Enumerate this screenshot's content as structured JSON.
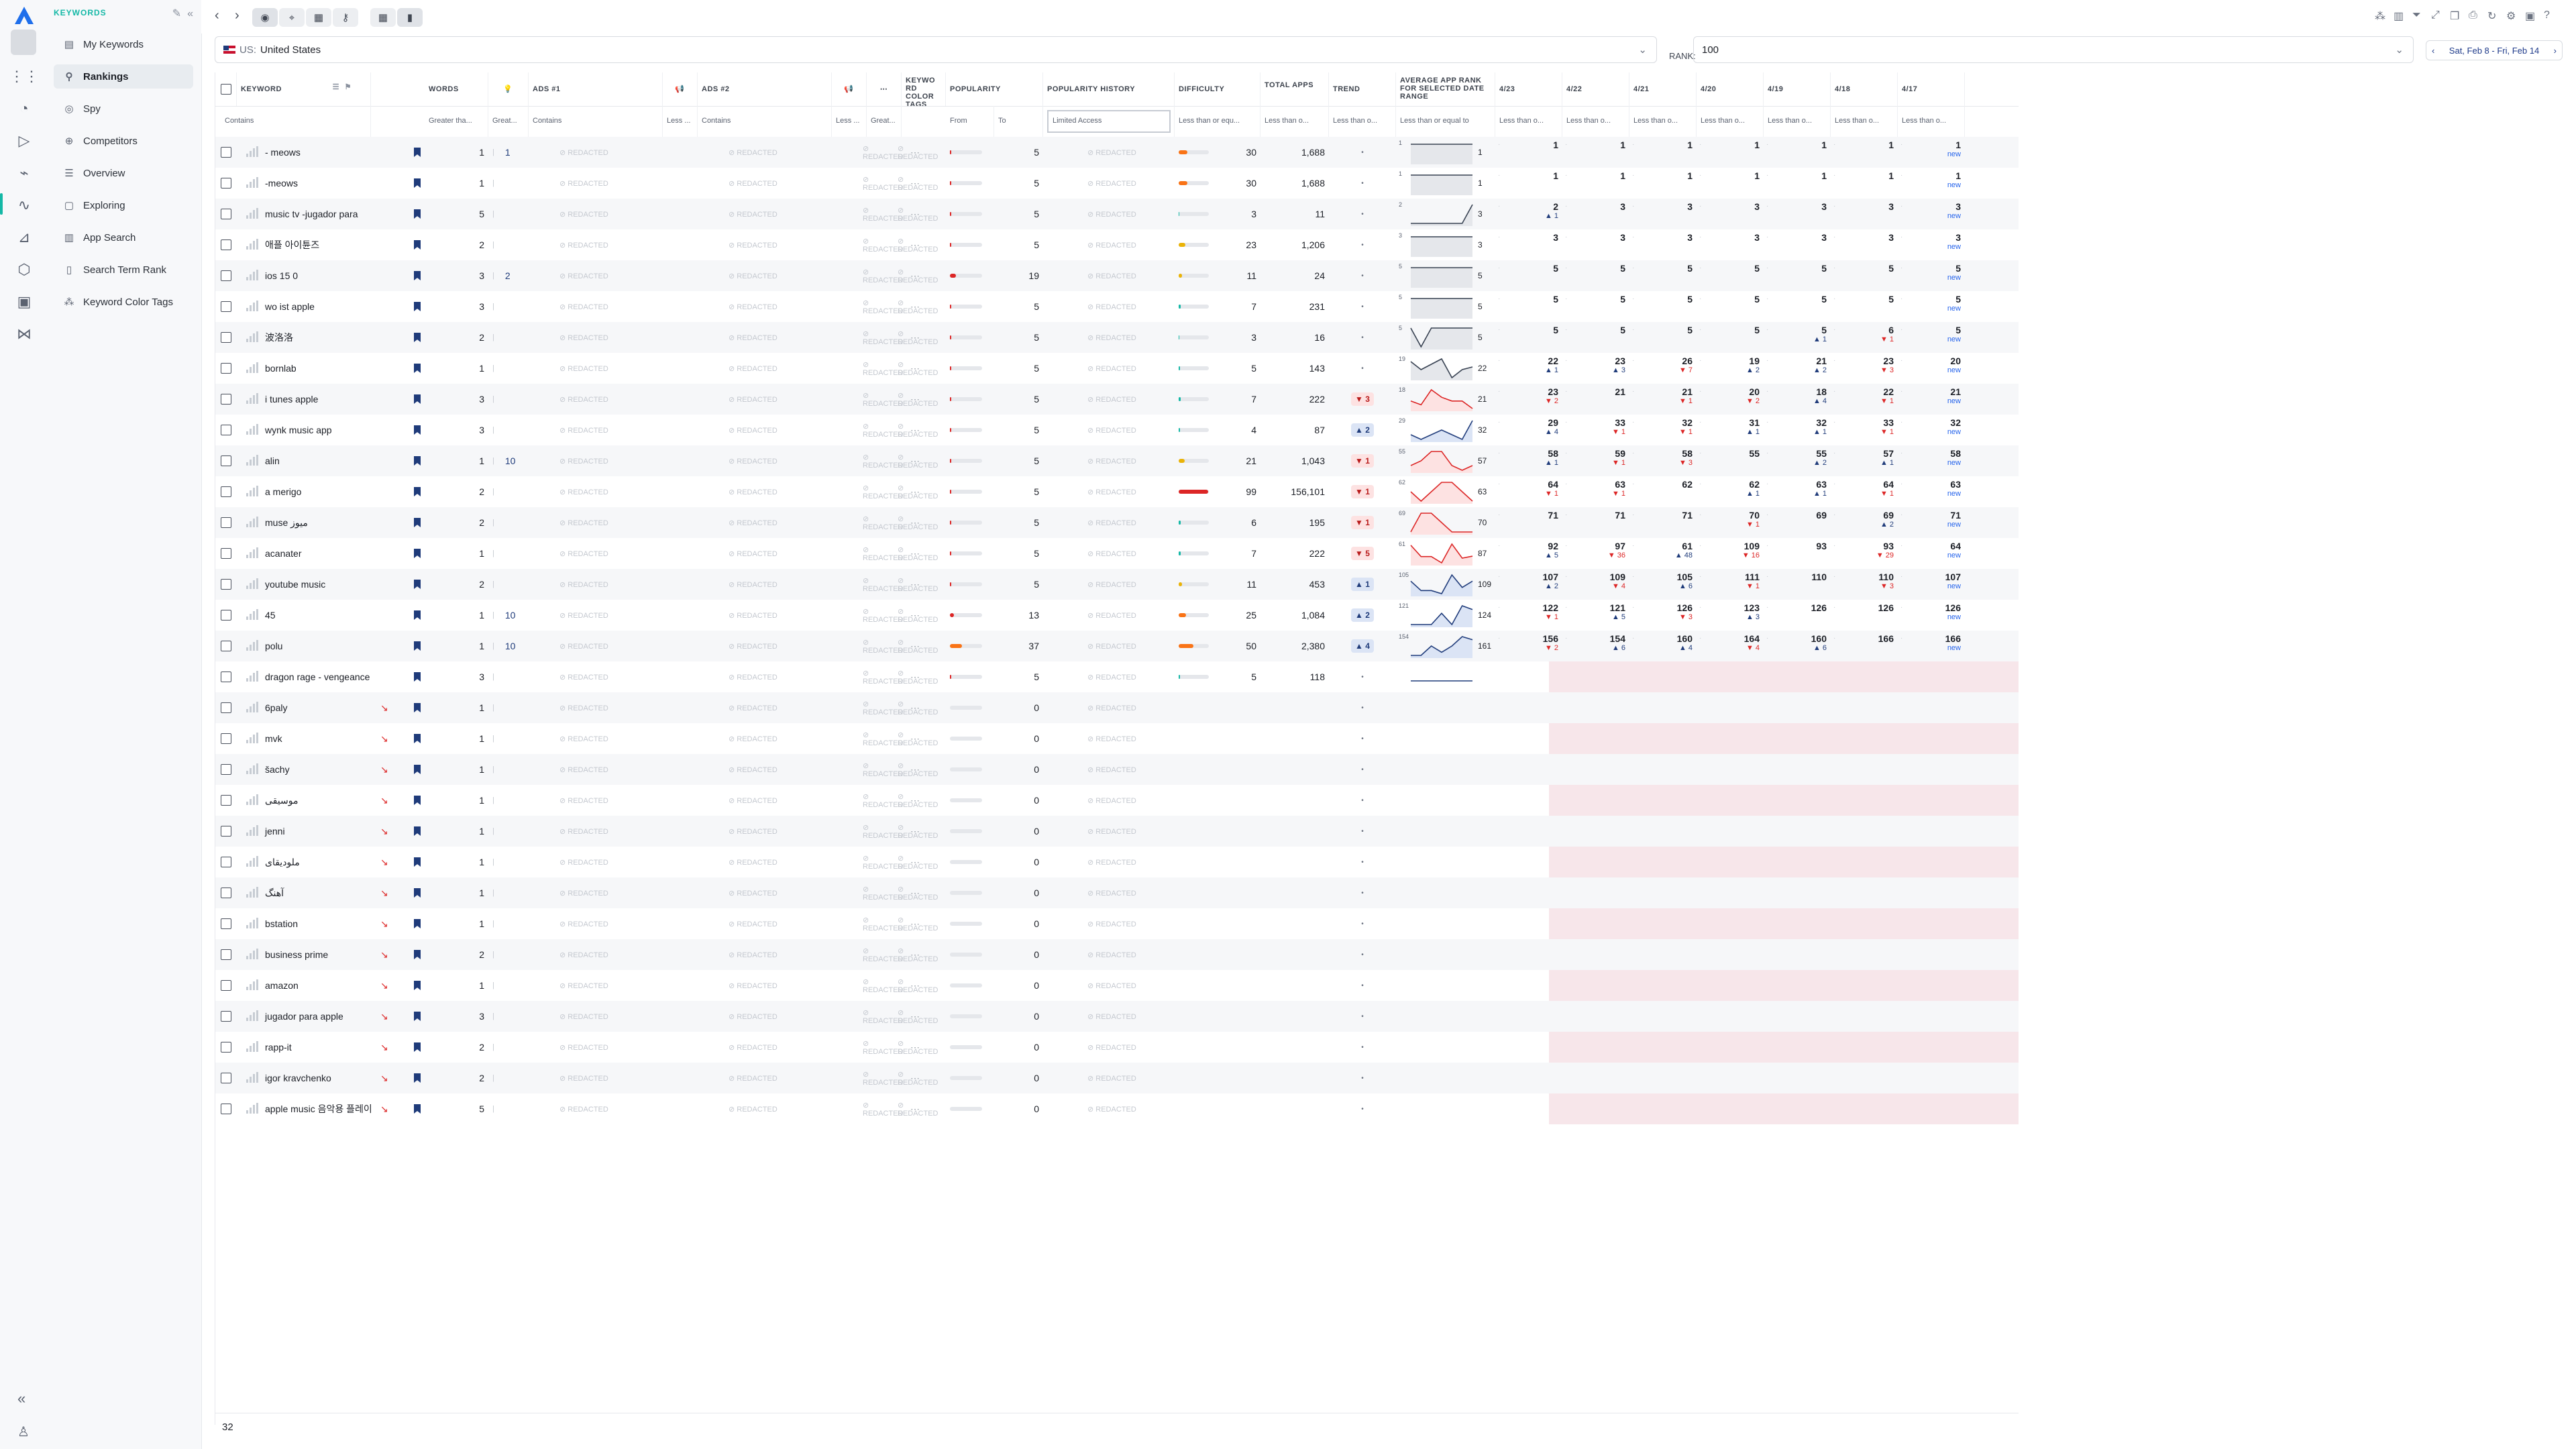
{
  "nav": {
    "section_title": "KEYWORDS",
    "items": [
      {
        "label": "My Keywords",
        "icon": "file-icon",
        "active": false
      },
      {
        "label": "Rankings",
        "icon": "search-icon",
        "active": true
      },
      {
        "label": "Spy",
        "icon": "spy-icon",
        "active": false
      },
      {
        "label": "Competitors",
        "icon": "target-icon",
        "active": false
      },
      {
        "label": "Overview",
        "icon": "list-icon",
        "active": false
      },
      {
        "label": "Exploring",
        "icon": "box-icon",
        "active": false
      },
      {
        "label": "App Search",
        "icon": "chart-icon",
        "active": false
      },
      {
        "label": "Search Term Rank",
        "icon": "doc-icon",
        "active": false
      },
      {
        "label": "Keyword Color Tags",
        "icon": "tags-icon",
        "active": false
      }
    ]
  },
  "filters": {
    "country_code": "US:",
    "country": "United States",
    "rank_label": "RANK:",
    "rank_value": "100",
    "date_range": "Sat, Feb 8 - Fri, Feb 14"
  },
  "columns": {
    "keyword": "KEYWORD",
    "words": "WORDS",
    "ads1": "ADS #1",
    "ads2": "ADS #2",
    "color_tags": "KEYWO RD COLOR TAGS",
    "popularity": "POPULARITY",
    "popularity_history": "POPULARITY HISTORY",
    "difficulty": "DIFFICULTY",
    "total_apps": "TOTAL APPS",
    "trend": "TREND",
    "avg_rank": "AVERAGE APP RANK FOR SELECTED DATE RANGE",
    "dates": [
      "4/23",
      "4/22",
      "4/21",
      "4/20",
      "4/19",
      "4/18",
      "4/17"
    ]
  },
  "filter_row": {
    "keyword": "Contains",
    "words": "Greater tha...",
    "bulb": "Great...",
    "ads1": "Contains",
    "ads1_less": "Less ...",
    "ads2": "Contains",
    "ads2_less": "Less ...",
    "ads2_great": "Great...",
    "pop_from": "From",
    "pop_to": "To",
    "pop_history": "Limited Access",
    "difficulty": "Less than or equ...",
    "total_apps": "Less than o...",
    "trend": "Less than o...",
    "avg_rank": "Less than or equal to",
    "date_filter": "Less than o..."
  },
  "rows": [
    {
      "keyword": "- meows",
      "words": "1",
      "bulb": "1",
      "pop": 5,
      "diff": 30,
      "total": "1,688",
      "trend": "•",
      "avg_start": "1",
      "avg": "1",
      "ranks": [
        [
          "1",
          ""
        ],
        [
          "1",
          ""
        ],
        [
          "1",
          ""
        ],
        [
          "1",
          ""
        ],
        [
          "1",
          ""
        ],
        [
          "1",
          ""
        ],
        [
          "1",
          "new"
        ]
      ]
    },
    {
      "keyword": "-meows",
      "words": "1",
      "bulb": "",
      "pop": 5,
      "diff": 30,
      "total": "1,688",
      "trend": "•",
      "avg_start": "1",
      "avg": "1",
      "ranks": [
        [
          "1",
          ""
        ],
        [
          "1",
          ""
        ],
        [
          "1",
          ""
        ],
        [
          "1",
          ""
        ],
        [
          "1",
          ""
        ],
        [
          "1",
          ""
        ],
        [
          "1",
          "new"
        ]
      ]
    },
    {
      "keyword": "music tv -jugador para",
      "words": "5",
      "bulb": "",
      "pop": 5,
      "diff": 3,
      "total": "11",
      "trend": "•",
      "avg_start": "2",
      "avg": "3",
      "ranks": [
        [
          "2",
          "▲ 1"
        ],
        [
          "3",
          ""
        ],
        [
          "3",
          ""
        ],
        [
          "3",
          ""
        ],
        [
          "3",
          ""
        ],
        [
          "3",
          ""
        ],
        [
          "3",
          "new"
        ]
      ]
    },
    {
      "keyword": "애플 아이튠즈",
      "words": "2",
      "bulb": "",
      "pop": 5,
      "diff": 23,
      "total": "1,206",
      "trend": "•",
      "avg_start": "3",
      "avg": "3",
      "ranks": [
        [
          "3",
          ""
        ],
        [
          "3",
          ""
        ],
        [
          "3",
          ""
        ],
        [
          "3",
          ""
        ],
        [
          "3",
          ""
        ],
        [
          "3",
          ""
        ],
        [
          "3",
          "new"
        ]
      ]
    },
    {
      "keyword": "ios 15 0",
      "words": "3",
      "bulb": "2",
      "pop": 19,
      "diff": 11,
      "total": "24",
      "trend": "•",
      "avg_start": "5",
      "avg": "5",
      "ranks": [
        [
          "5",
          ""
        ],
        [
          "5",
          ""
        ],
        [
          "5",
          ""
        ],
        [
          "5",
          ""
        ],
        [
          "5",
          ""
        ],
        [
          "5",
          ""
        ],
        [
          "5",
          "new"
        ]
      ]
    },
    {
      "keyword": "wo ist apple",
      "words": "3",
      "bulb": "",
      "pop": 5,
      "diff": 7,
      "total": "231",
      "trend": "•",
      "avg_start": "5",
      "avg": "5",
      "ranks": [
        [
          "5",
          ""
        ],
        [
          "5",
          ""
        ],
        [
          "5",
          ""
        ],
        [
          "5",
          ""
        ],
        [
          "5",
          ""
        ],
        [
          "5",
          ""
        ],
        [
          "5",
          "new"
        ]
      ]
    },
    {
      "keyword": "波洛洛",
      "words": "2",
      "bulb": "",
      "pop": 5,
      "diff": 3,
      "total": "16",
      "trend": "•",
      "avg_start": "5",
      "avg": "5",
      "ranks": [
        [
          "5",
          ""
        ],
        [
          "5",
          ""
        ],
        [
          "5",
          ""
        ],
        [
          "5",
          ""
        ],
        [
          "5",
          "▲ 1"
        ],
        [
          "6",
          "▼ 1"
        ],
        [
          "5",
          "new"
        ]
      ]
    },
    {
      "keyword": "bornlab",
      "words": "1",
      "bulb": "",
      "pop": 5,
      "diff": 5,
      "total": "143",
      "trend": "•",
      "avg_start": "19",
      "avg": "22",
      "ranks": [
        [
          "22",
          "▲ 1"
        ],
        [
          "23",
          "▲ 3"
        ],
        [
          "26",
          "▼ 7"
        ],
        [
          "19",
          "▲ 2"
        ],
        [
          "21",
          "▲ 2"
        ],
        [
          "23",
          "▼ 3"
        ],
        [
          "20",
          "new"
        ]
      ]
    },
    {
      "keyword": "i tunes apple",
      "words": "3",
      "bulb": "",
      "pop": 5,
      "diff": 7,
      "total": "222",
      "trend": "▼ 3",
      "avg_start": "18",
      "avg": "21",
      "ranks": [
        [
          "23",
          "▼ 2"
        ],
        [
          "21",
          ""
        ],
        [
          "21",
          "▼ 1"
        ],
        [
          "20",
          "▼ 2"
        ],
        [
          "18",
          "▲ 4"
        ],
        [
          "22",
          "▼ 1"
        ],
        [
          "21",
          "new"
        ]
      ]
    },
    {
      "keyword": "wynk music app",
      "words": "3",
      "bulb": "",
      "pop": 5,
      "diff": 4,
      "total": "87",
      "trend": "▲ 2",
      "avg_start": "29",
      "avg": "32",
      "ranks": [
        [
          "29",
          "▲ 4"
        ],
        [
          "33",
          "▼ 1"
        ],
        [
          "32",
          "▼ 1"
        ],
        [
          "31",
          "▲ 1"
        ],
        [
          "32",
          "▲ 1"
        ],
        [
          "33",
          "▼ 1"
        ],
        [
          "32",
          "new"
        ]
      ]
    },
    {
      "keyword": "alin",
      "words": "1",
      "bulb": "10",
      "pop": 5,
      "diff": 21,
      "total": "1,043",
      "trend": "▼ 1",
      "avg_start": "55",
      "avg": "57",
      "ranks": [
        [
          "58",
          "▲ 1"
        ],
        [
          "59",
          "▼ 1"
        ],
        [
          "58",
          "▼ 3"
        ],
        [
          "55",
          ""
        ],
        [
          "55",
          "▲ 2"
        ],
        [
          "57",
          "▲ 1"
        ],
        [
          "58",
          "new"
        ]
      ]
    },
    {
      "keyword": "a merigo",
      "words": "2",
      "bulb": "",
      "pop": 5,
      "diff": 99,
      "total": "156,101",
      "trend": "▼ 1",
      "avg_start": "62",
      "avg": "63",
      "ranks": [
        [
          "64",
          "▼ 1"
        ],
        [
          "63",
          "▼ 1"
        ],
        [
          "62",
          ""
        ],
        [
          "62",
          "▲ 1"
        ],
        [
          "63",
          "▲ 1"
        ],
        [
          "64",
          "▼ 1"
        ],
        [
          "63",
          "new"
        ]
      ]
    },
    {
      "keyword": "muse ميوز",
      "words": "2",
      "bulb": "",
      "pop": 5,
      "diff": 6,
      "total": "195",
      "trend": "▼ 1",
      "avg_start": "69",
      "avg": "70",
      "ranks": [
        [
          "71",
          ""
        ],
        [
          "71",
          ""
        ],
        [
          "71",
          ""
        ],
        [
          "70",
          "▼ 1"
        ],
        [
          "69",
          ""
        ],
        [
          "69",
          "▲ 2"
        ],
        [
          "71",
          "new"
        ]
      ]
    },
    {
      "keyword": "acanater",
      "words": "1",
      "bulb": "",
      "pop": 5,
      "diff": 7,
      "total": "222",
      "trend": "▼ 5",
      "avg_start": "61",
      "avg": "87",
      "ranks": [
        [
          "92",
          "▲ 5"
        ],
        [
          "97",
          "▼ 36"
        ],
        [
          "61",
          "▲ 48"
        ],
        [
          "109",
          "▼ 16"
        ],
        [
          "93",
          ""
        ],
        [
          "93",
          "▼ 29"
        ],
        [
          "64",
          "new"
        ]
      ]
    },
    {
      "keyword": "youtube music",
      "words": "2",
      "bulb": "",
      "pop": 5,
      "diff": 11,
      "total": "453",
      "trend": "▲ 1",
      "avg_start": "105",
      "avg": "109",
      "ranks": [
        [
          "107",
          "▲ 2"
        ],
        [
          "109",
          "▼ 4"
        ],
        [
          "105",
          "▲ 6"
        ],
        [
          "111",
          "▼ 1"
        ],
        [
          "110",
          ""
        ],
        [
          "110",
          "▼ 3"
        ],
        [
          "107",
          "new"
        ]
      ]
    },
    {
      "keyword": "45",
      "words": "1",
      "bulb": "10",
      "pop": 13,
      "diff": 25,
      "total": "1,084",
      "trend": "▲ 2",
      "avg_start": "121",
      "avg": "124",
      "ranks": [
        [
          "122",
          "▼ 1"
        ],
        [
          "121",
          "▲ 5"
        ],
        [
          "126",
          "▼ 3"
        ],
        [
          "123",
          "▲ 3"
        ],
        [
          "126",
          ""
        ],
        [
          "126",
          ""
        ],
        [
          "126",
          "new"
        ]
      ]
    },
    {
      "keyword": "polu",
      "words": "1",
      "bulb": "10",
      "pop": 37,
      "diff": 50,
      "total": "2,380",
      "trend": "▲ 4",
      "avg_start": "154",
      "avg": "161",
      "ranks": [
        [
          "156",
          "▼ 2"
        ],
        [
          "154",
          "▲ 6"
        ],
        [
          "160",
          "▲ 4"
        ],
        [
          "164",
          "▼ 4"
        ],
        [
          "160",
          "▲ 6"
        ],
        [
          "166",
          ""
        ],
        [
          "166",
          "new"
        ]
      ]
    },
    {
      "keyword": "dragon rage - vengeance",
      "words": "3",
      "bulb": "",
      "pop": 5,
      "diff": 5,
      "total": "118",
      "trend": "•",
      "avg_start": "",
      "avg": "",
      "ranks": []
    },
    {
      "keyword": "6paly",
      "words": "1",
      "bulb": "",
      "pop": 0,
      "diff": null,
      "total": "",
      "trend": "•",
      "avg_start": "",
      "avg": "",
      "ranks": []
    },
    {
      "keyword": "mvk",
      "words": "1",
      "bulb": "",
      "pop": 0,
      "diff": null,
      "total": "",
      "trend": "•",
      "avg_start": "",
      "avg": "",
      "ranks": []
    },
    {
      "keyword": "šachy",
      "words": "1",
      "bulb": "",
      "pop": 0,
      "diff": null,
      "total": "",
      "trend": "•",
      "avg_start": "",
      "avg": "",
      "ranks": []
    },
    {
      "keyword": "موسيقى",
      "words": "1",
      "bulb": "",
      "pop": 0,
      "diff": null,
      "total": "",
      "trend": "•",
      "avg_start": "",
      "avg": "",
      "ranks": []
    },
    {
      "keyword": "jenni",
      "words": "1",
      "bulb": "",
      "pop": 0,
      "diff": null,
      "total": "",
      "trend": "•",
      "avg_start": "",
      "avg": "",
      "ranks": []
    },
    {
      "keyword": "ملوديقای",
      "words": "1",
      "bulb": "",
      "pop": 0,
      "diff": null,
      "total": "",
      "trend": "•",
      "avg_start": "",
      "avg": "",
      "ranks": []
    },
    {
      "keyword": "آهنگ",
      "words": "1",
      "bulb": "",
      "pop": 0,
      "diff": null,
      "total": "",
      "trend": "•",
      "avg_start": "",
      "avg": "",
      "ranks": []
    },
    {
      "keyword": "bstation",
      "words": "1",
      "bulb": "",
      "pop": 0,
      "diff": null,
      "total": "",
      "trend": "•",
      "avg_start": "",
      "avg": "",
      "ranks": []
    },
    {
      "keyword": "business prime",
      "words": "2",
      "bulb": "",
      "pop": 0,
      "diff": null,
      "total": "",
      "trend": "•",
      "avg_start": "",
      "avg": "",
      "ranks": []
    },
    {
      "keyword": "amazon",
      "words": "1",
      "bulb": "",
      "pop": 0,
      "diff": null,
      "total": "",
      "trend": "•",
      "avg_start": "",
      "avg": "",
      "ranks": []
    },
    {
      "keyword": "jugador para apple",
      "words": "3",
      "bulb": "",
      "pop": 0,
      "diff": null,
      "total": "",
      "trend": "•",
      "avg_start": "",
      "avg": "",
      "ranks": []
    },
    {
      "keyword": "rapp-it",
      "words": "2",
      "bulb": "",
      "pop": 0,
      "diff": null,
      "total": "",
      "trend": "•",
      "avg_start": "",
      "avg": "",
      "ranks": []
    },
    {
      "keyword": "igor kravchenko",
      "words": "2",
      "bulb": "",
      "pop": 0,
      "diff": null,
      "total": "",
      "trend": "•",
      "avg_start": "",
      "avg": "",
      "ranks": []
    },
    {
      "keyword": "apple music 음악용 플레이",
      "words": "5",
      "bulb": "",
      "pop": 0,
      "diff": null,
      "total": "",
      "trend": "•",
      "avg_start": "",
      "avg": "",
      "ranks": []
    }
  ],
  "footer": {
    "count": "32"
  },
  "placeholder_text": "⊘ REDACTED",
  "colors": {
    "accent": "#14b8a6",
    "brand": "#1f3b7a",
    "negative": "#dc2626",
    "pink": "#f7e6ea"
  }
}
